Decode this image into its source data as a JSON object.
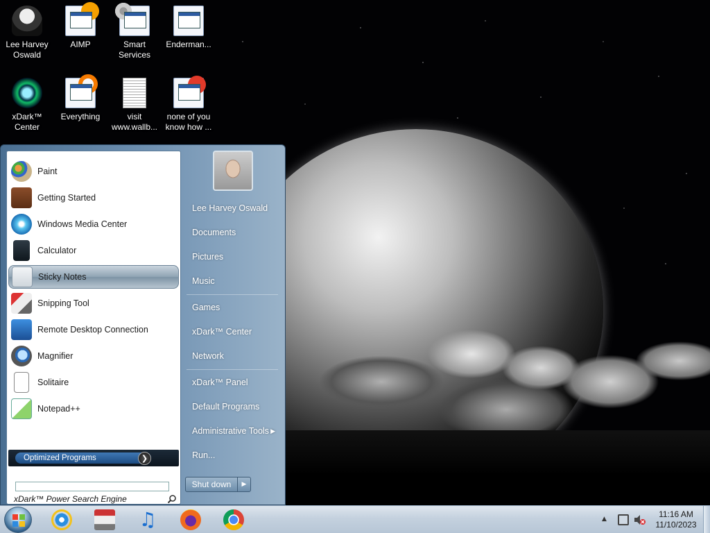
{
  "desktop": {
    "icons": [
      {
        "label": "Lee Harvey Oswald",
        "icon": "user-folder-icon"
      },
      {
        "label": "AIMP",
        "icon": "aimp-icon"
      },
      {
        "label": "Smart Services",
        "icon": "smart-services-icon"
      },
      {
        "label": "Enderman...",
        "icon": "enderman-icon"
      },
      {
        "label": "xDark™ Center",
        "icon": "xdark-center-icon"
      },
      {
        "label": "Everything",
        "icon": "everything-icon"
      },
      {
        "label": "visit www.wallb...",
        "icon": "text-document-icon"
      },
      {
        "label": "none of you know how ...",
        "icon": "red-app-icon"
      }
    ]
  },
  "start_menu": {
    "programs": [
      {
        "label": "Paint",
        "icon": "paint-icon"
      },
      {
        "label": "Getting Started",
        "icon": "getting-started-icon"
      },
      {
        "label": "Windows Media Center",
        "icon": "media-center-icon"
      },
      {
        "label": "Calculator",
        "icon": "calculator-icon"
      },
      {
        "label": "Sticky Notes",
        "icon": "sticky-notes-icon"
      },
      {
        "label": "Snipping Tool",
        "icon": "snipping-tool-icon"
      },
      {
        "label": "Remote Desktop Connection",
        "icon": "remote-desktop-icon"
      },
      {
        "label": "Magnifier",
        "icon": "magnifier-icon"
      },
      {
        "label": "Solitaire",
        "icon": "solitaire-icon"
      },
      {
        "label": "Notepad++",
        "icon": "notepadpp-icon"
      }
    ],
    "optimized_label": "Optimized Programs",
    "search_label": "xDark™ Power Search Engine",
    "right_items": [
      "Lee Harvey Oswald",
      "Documents",
      "Pictures",
      "Music",
      "Games",
      "xDark™ Center",
      "Network",
      "xDark™ Panel",
      "Default Programs",
      "Administrative Tools",
      "Run..."
    ],
    "shutdown_label": "Shut down"
  },
  "taskbar": {
    "apps": [
      "internet-explorer-icon",
      "media-app-icon",
      "music-note-icon",
      "firefox-icon",
      "chrome-icon"
    ],
    "clock_time": "11:16 AM",
    "clock_date": "11/10/2023"
  },
  "colors": {
    "start_menu_accent": "#6d8fb0",
    "taskbar_bg": "#c4d1de",
    "selected_item": "#8fa3b3"
  }
}
